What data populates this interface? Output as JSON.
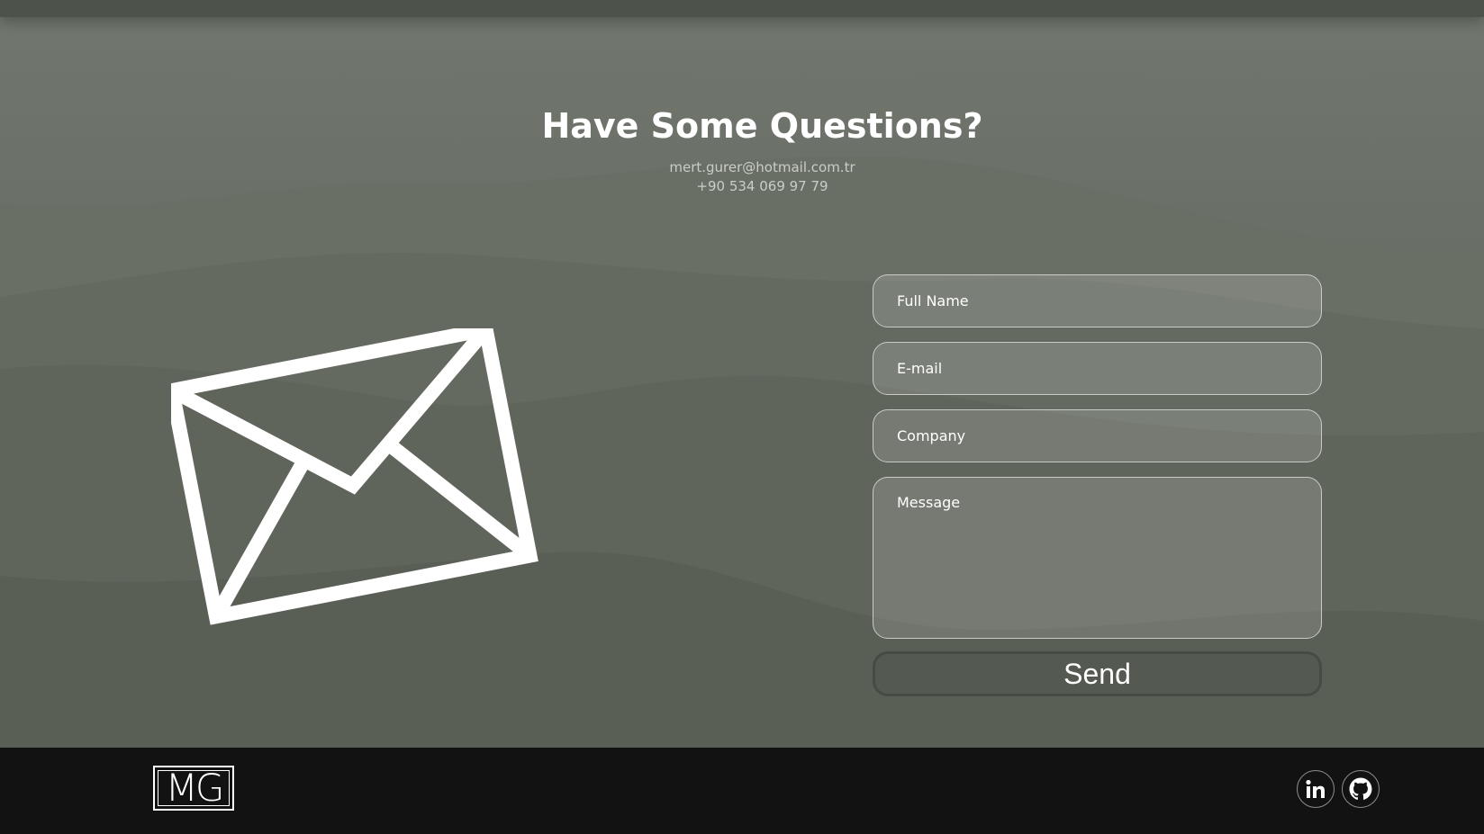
{
  "contact": {
    "heading": "Have Some Questions?",
    "email": "mert.gurer@hotmail.com.tr",
    "phone": "+90 534 069 97 79"
  },
  "form": {
    "full_name_placeholder": "Full Name",
    "email_placeholder": "E-mail",
    "company_placeholder": "Company",
    "message_placeholder": "Message",
    "send_label": "Send"
  },
  "footer": {
    "logo_text": "MG",
    "social_icons": [
      "linkedin-icon",
      "github-icon"
    ]
  },
  "colors": {
    "background": "#5c6158",
    "footer": "#121212",
    "text": "#ffffff"
  }
}
